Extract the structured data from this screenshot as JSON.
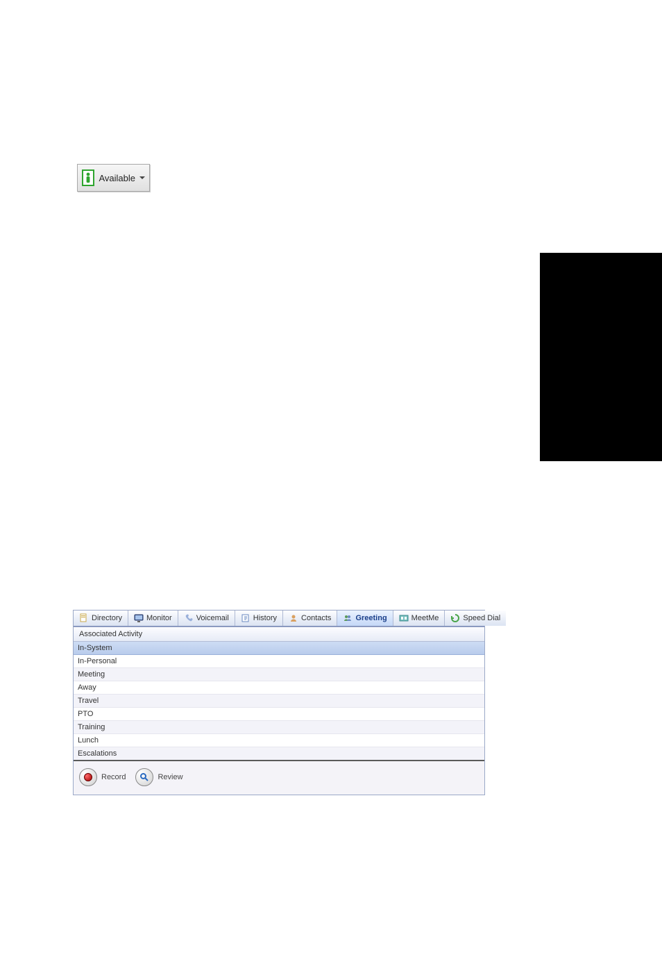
{
  "available_button": {
    "label": "Available"
  },
  "tabs": [
    {
      "label": "Directory",
      "active": false,
      "icon": "page-icon"
    },
    {
      "label": "Monitor",
      "active": false,
      "icon": "monitor-icon"
    },
    {
      "label": "Voicemail",
      "active": false,
      "icon": "phone-icon"
    },
    {
      "label": "History",
      "active": false,
      "icon": "history-icon"
    },
    {
      "label": "Contacts",
      "active": false,
      "icon": "contacts-icon"
    },
    {
      "label": "Greeting",
      "active": true,
      "icon": "greeting-icon"
    },
    {
      "label": "MeetMe",
      "active": false,
      "icon": "meetme-icon"
    },
    {
      "label": "Speed Dial",
      "active": false,
      "icon": "speeddial-icon"
    }
  ],
  "column_header": "Associated Activity",
  "activities": [
    {
      "label": "In-System",
      "selected": true
    },
    {
      "label": "In-Personal",
      "selected": false
    },
    {
      "label": "Meeting",
      "selected": false
    },
    {
      "label": "Away",
      "selected": false
    },
    {
      "label": "Travel",
      "selected": false
    },
    {
      "label": "PTO",
      "selected": false
    },
    {
      "label": "Training",
      "selected": false
    },
    {
      "label": "Lunch",
      "selected": false
    },
    {
      "label": "Escalations",
      "selected": false
    }
  ],
  "footer": {
    "record_label": "Record",
    "review_label": "Review"
  }
}
